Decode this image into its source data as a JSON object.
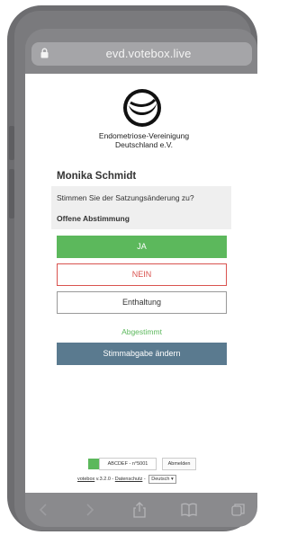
{
  "browser": {
    "url": "evd.votebox.live"
  },
  "org": {
    "line1": "Endometriose-Vereinigung",
    "line2": "Deutschland e.V."
  },
  "voter": {
    "name": "Monika Schmidt"
  },
  "poll": {
    "question": "Stimmen Sie der Satzungsänderung zu?",
    "status": "Offene Abstimmung"
  },
  "options": {
    "yes": "JA",
    "no": "NEIN",
    "abstain": "Enthaltung"
  },
  "vote_status": "Abgestimmt",
  "change_vote": "Stimmabgabe ändern",
  "footer": {
    "code": "ABCDEF - n°5001",
    "logout": "Abmelden",
    "brand": "votebox",
    "version": "v.3.2.0 -",
    "privacy": "Datenschutz",
    "separator": "-",
    "language": "Deutsch"
  },
  "colors": {
    "accent_green": "#5cb85c",
    "danger_red": "#d9534f",
    "slate_button": "#5a7a8f"
  },
  "icons": {
    "toolbar": [
      "back-icon",
      "forward-icon",
      "share-icon",
      "bookmarks-icon",
      "tabs-icon"
    ]
  }
}
